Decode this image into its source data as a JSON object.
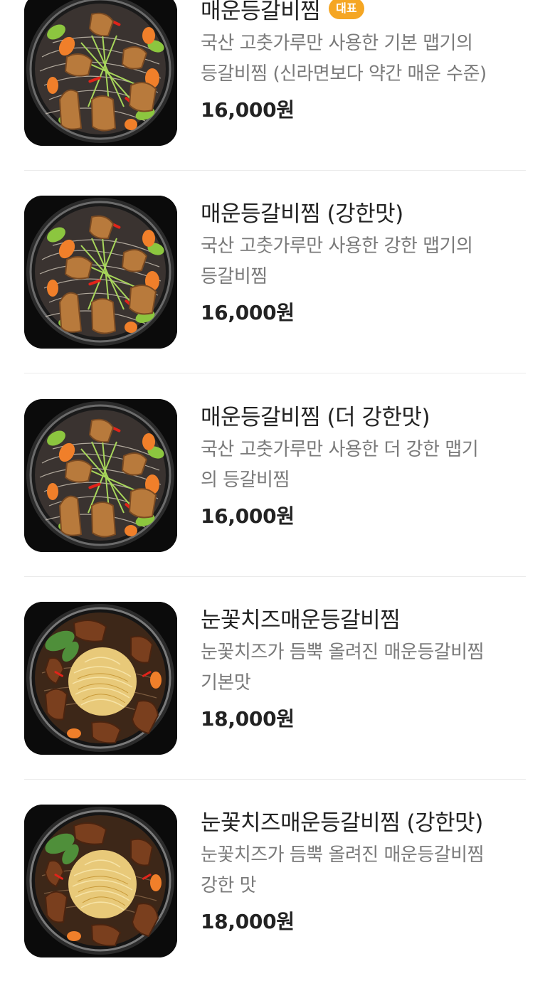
{
  "menu": {
    "items": [
      {
        "name": "매운등갈비찜",
        "badge": "대표",
        "desc_line1": "국산 고춧가루만 사용한 기본 맵기의",
        "desc_line2": "등갈비찜 (신라면보다 약간 매운 수준)",
        "price": "16,000원",
        "image": "spicy-ribs-photo"
      },
      {
        "name": "매운등갈비찜 (강한맛)",
        "desc_line1": "국산 고춧가루만 사용한 강한 맵기의",
        "desc_line2": "등갈비찜",
        "price": "16,000원",
        "image": "spicy-ribs-photo"
      },
      {
        "name": "매운등갈비찜 (더 강한맛)",
        "desc_line1": "국산 고춧가루만 사용한 더 강한 맵기",
        "desc_line2": "의 등갈비찜",
        "price": "16,000원",
        "image": "spicy-ribs-photo"
      },
      {
        "name": "눈꽃치즈매운등갈비찜",
        "desc_line1": "눈꽃치즈가 듬뿍 올려진 매운등갈비찜",
        "desc_line2": "기본맛",
        "price": "18,000원",
        "image": "cheese-ribs-photo"
      },
      {
        "name": "눈꽃치즈매운등갈비찜 (강한맛)",
        "desc_line1": "눈꽃치즈가 듬뿍 올려진 매운등갈비찜",
        "desc_line2": "강한 맛",
        "price": "18,000원",
        "image": "cheese-ribs-photo"
      }
    ]
  },
  "colors": {
    "badge": "#f5a623",
    "text": "#222222",
    "description": "#7a7a7a",
    "divider": "#ebebeb"
  }
}
